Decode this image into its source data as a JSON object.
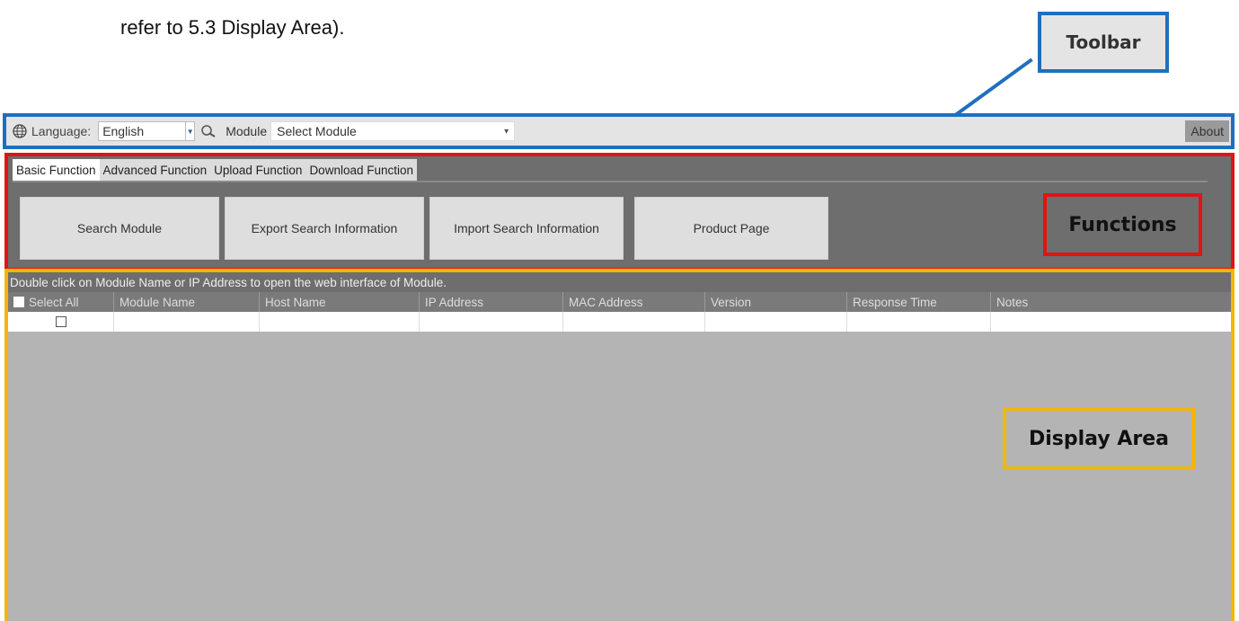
{
  "intro_text": "refer to 5.3 Display Area).",
  "callouts": {
    "toolbar": "Toolbar",
    "functions": "Functions",
    "display_area": "Display Area"
  },
  "colors": {
    "toolbar_outline": "#1f6fbf",
    "functions_outline": "#e01414",
    "display_outline": "#f2b705"
  },
  "toolbar": {
    "language_icon": "globe-icon",
    "language_label": "Language:",
    "language_value": "English",
    "module_icon": "search-icon",
    "module_label": "Module",
    "module_placeholder": "Select Module",
    "about_label": "About"
  },
  "functions": {
    "tabs": [
      {
        "label": "Basic Function",
        "active": true
      },
      {
        "label": "Advanced Function",
        "active": false
      },
      {
        "label": "Upload Function",
        "active": false
      },
      {
        "label": "Download Function",
        "active": false
      }
    ],
    "buttons": [
      {
        "label": "Search Module"
      },
      {
        "label": "Export Search Information"
      },
      {
        "label": "Import Search Information"
      },
      {
        "label": "Product Page"
      }
    ]
  },
  "display": {
    "hint": "Double click on Module Name or IP Address to open the web interface of Module.",
    "columns": [
      "Select All",
      "Module Name",
      "Host Name",
      "IP Address",
      "MAC Address",
      "Version",
      "Response Time",
      "Notes"
    ]
  }
}
